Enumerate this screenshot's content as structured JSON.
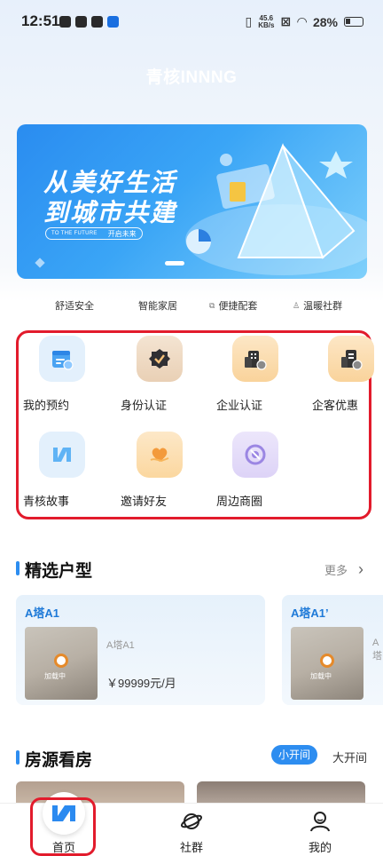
{
  "status_bar": {
    "time": "12:51",
    "net_speed_value": "45.6",
    "net_speed_unit": "KB/s",
    "battery": "28%"
  },
  "app_title": "青核INNNG",
  "banner": {
    "headline_line1": "从美好生活",
    "headline_line2": "到城市共建",
    "pill_en": "TO THE FUTURE",
    "pill_cn": "开启未来"
  },
  "features": [
    {
      "label": "舒适安全"
    },
    {
      "label": "智能家居"
    },
    {
      "label": "便捷配套"
    },
    {
      "label": "温暖社群"
    }
  ],
  "grid": [
    {
      "label": "我的预约",
      "icon": "calendar-check-icon"
    },
    {
      "label": "身份认证",
      "icon": "verified-badge-icon"
    },
    {
      "label": "企业认证",
      "icon": "building-check-icon"
    },
    {
      "label": "企客优惠",
      "icon": "building-discount-icon"
    },
    {
      "label": "青核故事",
      "icon": "brand-logo-icon"
    },
    {
      "label": "邀请好友",
      "icon": "heart-hand-icon"
    },
    {
      "label": "周边商圈",
      "icon": "shopping-circle-icon"
    }
  ],
  "section_layouts": {
    "title": "精选户型",
    "more": "更多"
  },
  "cards": [
    {
      "title": "A塔A1",
      "sub": "A塔A1",
      "price": "￥99999元/月",
      "thumb_text": "加载中"
    },
    {
      "title": "A塔A1’",
      "sub": "A塔",
      "price": "",
      "thumb_text": "加载中"
    }
  ],
  "section_viewing": {
    "title": "房源看房",
    "tab_active": "小开间",
    "tab_other": "大开间"
  },
  "tabbar": {
    "home": "首页",
    "community": "社群",
    "mine": "我的"
  },
  "colors": {
    "accent": "#2d8df0",
    "highlight_outline": "#e21b2c"
  }
}
